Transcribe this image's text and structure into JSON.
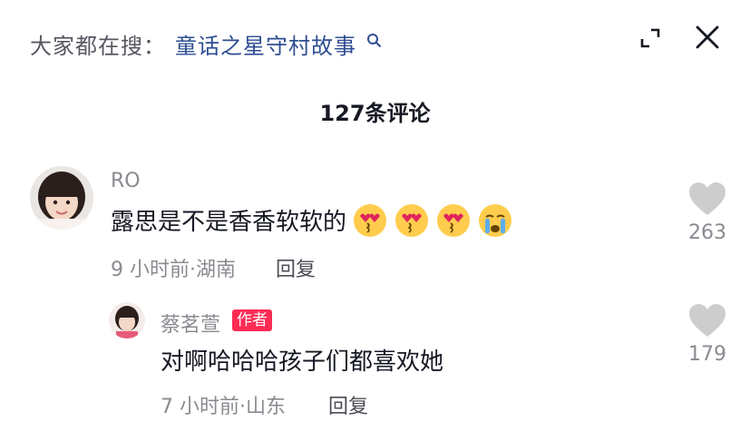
{
  "header": {
    "search_prefix": "大家都在搜：",
    "search_term": "童话之星守村故事",
    "comment_count_title": "127条评论"
  },
  "comments": [
    {
      "username": "RO",
      "text": "露思是不是香香软软的",
      "emojis": [
        "heart-eyes-kiss-icon",
        "heart-eyes-kiss-icon",
        "heart-eyes-kiss-icon",
        "crying-face-icon"
      ],
      "time": "9 小时前",
      "location": "湖南",
      "reply_label": "回复",
      "likes": "263",
      "replies": [
        {
          "username": "蔡茗萱",
          "badge": "作者",
          "text": "对啊哈哈哈孩子们都喜欢她",
          "time": "7 小时前",
          "location": "山东",
          "reply_label": "回复",
          "likes": "179"
        }
      ]
    }
  ],
  "colors": {
    "accent_link": "#2f4e91",
    "author_badge": "#fe2c55",
    "secondary_text": "#8a8b91"
  }
}
